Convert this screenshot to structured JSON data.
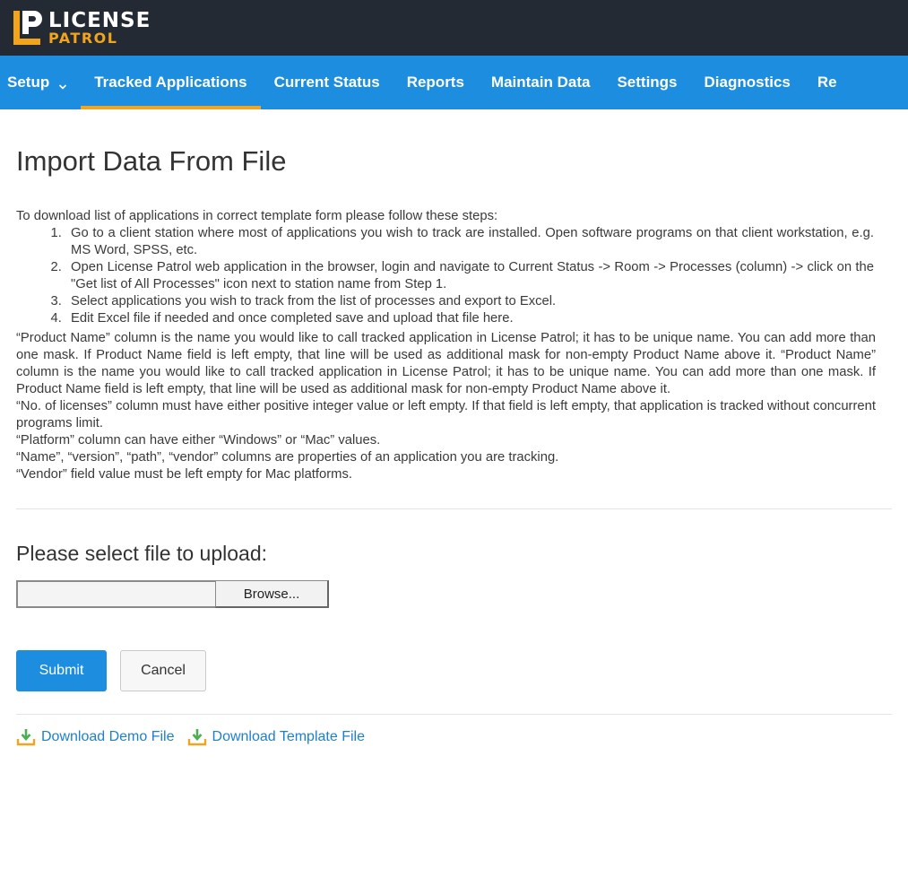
{
  "brand": {
    "line1": "LICENSE",
    "line2": "PATROL"
  },
  "nav": {
    "items": [
      {
        "label": "Setup",
        "dropdown": true,
        "active": false
      },
      {
        "label": "Tracked Applications",
        "active": true
      },
      {
        "label": "Current Status",
        "active": false
      },
      {
        "label": "Reports",
        "active": false
      },
      {
        "label": "Maintain Data",
        "active": false
      },
      {
        "label": "Settings",
        "active": false
      },
      {
        "label": "Diagnostics",
        "active": false
      },
      {
        "label": "Re",
        "active": false
      }
    ]
  },
  "page": {
    "title": "Import Data From File",
    "intro": "To download list of applications in correct template form please follow these steps:",
    "steps": [
      "Go to a client station where most of applications you wish to track are installed. Open software programs on that client workstation, e.g. MS Word, SPSS, etc.",
      "Open License Patrol web application in the browser, login and navigate to Current Status -> Room -> Processes (column) -> click on the \"Get list of All Processes\" icon next to station name from Step 1.",
      "Select applications you wish to track from the list of processes and export to Excel.",
      "Edit Excel file if needed and once completed save and upload that file here."
    ],
    "notes": [
      "“Product Name” column is the name you would like to call tracked application in License Patrol; it has to be unique name. You can add more than one mask. If Product Name field is left empty, that line will be used as additional mask for non-empty Product Name above it. “Product Name” column is the name you would like to call tracked application in License Patrol; it has to be unique name. You can add more than one mask. If Product Name field is left empty, that line will be used as additional mask for non-empty Product Name above it.",
      "“No. of licenses” column must have either positive integer value or left empty. If that field is left empty, that application is tracked without concurrent programs limit.",
      "“Platform” column can have either “Windows” or “Mac” values.",
      "“Name”, “version”, “path”, “vendor” columns are properties of an application you are tracking.",
      "“Vendor” field value must be left empty for Mac platforms."
    ]
  },
  "upload": {
    "heading": "Please select file to upload:",
    "file_value": "",
    "browse_label": "Browse..."
  },
  "actions": {
    "submit_label": "Submit",
    "cancel_label": "Cancel"
  },
  "downloads": [
    {
      "label": "Download Demo File",
      "icon": "download-icon"
    },
    {
      "label": "Download Template File",
      "icon": "download-icon"
    }
  ],
  "colors": {
    "topbar": "#232a33",
    "nav": "#1d8de0",
    "accent": "#f2a41c",
    "link": "#1d7fd0",
    "download_icon": "#4caf50"
  }
}
